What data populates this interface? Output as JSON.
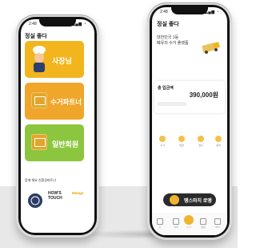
{
  "status_time": "2:48",
  "status_signal": "▂▄▆ ◔",
  "left_app": {
    "logo": "정실 좋다",
    "cards": [
      {
        "label": "사장님",
        "color": "#f2b51e"
      },
      {
        "label": "수거파트너",
        "color": "#f0a62a"
      },
      {
        "label": "일반회원",
        "color": "#8cc63f"
      }
    ],
    "partner_section_title": "함께 해요 친환경파트너",
    "partner_logos": [
      "HOW'S TOUCH",
      "Mango"
    ]
  },
  "right_app": {
    "logo": "정실 좋다",
    "greeting_line1": "대한민국 1등",
    "greeting_line2": "폐유의 수거 플랫폼",
    "greeting_highlight": "1등",
    "card_title": "총 입금액",
    "amount": "390,000원",
    "banner_text": "땡스마치 로앵",
    "icons": [
      "수거",
      "입금",
      "정산",
      "문의"
    ],
    "tabs": [
      "홈",
      "내역",
      "수거",
      "알림",
      "마이"
    ]
  },
  "colors": {
    "brand_yellow": "#f2b51e",
    "partner_orange": "#f0a62a",
    "member_green": "#8cc63f",
    "accent_blue": "#4a90e2",
    "banner_dark": "#2b2b2b"
  }
}
